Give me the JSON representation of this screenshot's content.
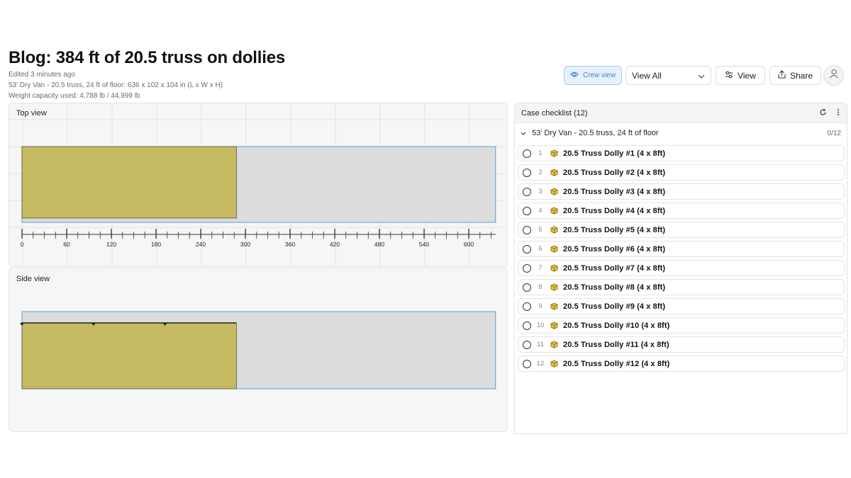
{
  "header": {
    "title": "Blog: 384 ft of 20.5 truss on dollies",
    "edited": "Edited 3 minutes ago",
    "container_info": "53' Dry Van - 20.5 truss, 24 ft of floor: 636 x 102 x 104 in (L x W x H)",
    "weight": "Weight capacity used: 4,788 lb / 44,999 lb"
  },
  "toolbar": {
    "crew_view_label": "Crew view",
    "view_select_value": "View All",
    "view_label": "View",
    "share_label": "Share"
  },
  "top_view": {
    "label": "Top view",
    "ruler_ticks": [
      "0",
      "60",
      "120",
      "180",
      "240",
      "300",
      "360",
      "420",
      "480",
      "540",
      "600"
    ]
  },
  "side_view": {
    "label": "Side view"
  },
  "load": {
    "container_length_in": 636,
    "loaded_length_in": 288,
    "colors": {
      "cargo": "#c5b962",
      "container": "#dcdcdc",
      "outline": "#5b9bd8"
    }
  },
  "checklist": {
    "title": "Case checklist (12)",
    "group_name": "53' Dry Van - 20.5 truss, 24 ft of floor",
    "group_count": "0/12",
    "items": [
      {
        "num": "1",
        "name": "20.5 Truss Dolly #1 (4 x 8ft)"
      },
      {
        "num": "2",
        "name": "20.5 Truss Dolly #2 (4 x 8ft)"
      },
      {
        "num": "3",
        "name": "20.5 Truss Dolly #3 (4 x 8ft)"
      },
      {
        "num": "4",
        "name": "20.5 Truss Dolly #4 (4 x 8ft)"
      },
      {
        "num": "5",
        "name": "20.5 Truss Dolly #5 (4 x 8ft)"
      },
      {
        "num": "6",
        "name": "20.5 Truss Dolly #6 (4 x 8ft)"
      },
      {
        "num": "7",
        "name": "20.5 Truss Dolly #7 (4 x 8ft)"
      },
      {
        "num": "8",
        "name": "20.5 Truss Dolly #8 (4 x 8ft)"
      },
      {
        "num": "9",
        "name": "20.5 Truss Dolly #9 (4 x 8ft)"
      },
      {
        "num": "10",
        "name": "20.5 Truss Dolly #10 (4 x 8ft)"
      },
      {
        "num": "11",
        "name": "20.5 Truss Dolly #11 (4 x 8ft)"
      },
      {
        "num": "12",
        "name": "20.5 Truss Dolly #12 (4 x 8ft)"
      }
    ]
  },
  "icons": {
    "crew": "eye-icon",
    "select": "chevron-down-icon",
    "view": "sliders-icon",
    "share": "share-icon",
    "avatar": "user-icon",
    "refresh": "refresh-icon",
    "more": "more-vertical-icon",
    "group_toggle": "chevron-down-icon",
    "item": "box-icon"
  }
}
